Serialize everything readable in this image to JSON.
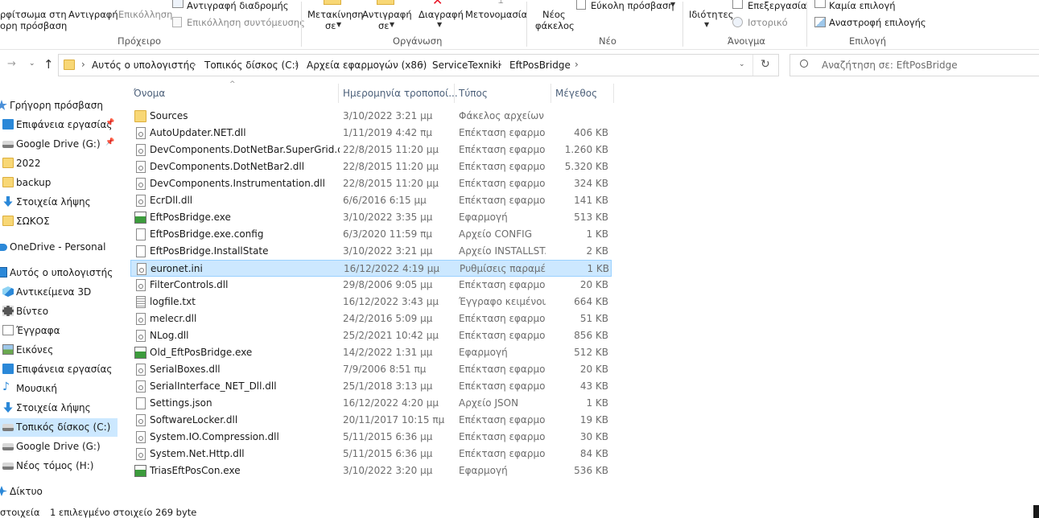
{
  "ribbon": {
    "clipboard": {
      "pin_label_1": "ρφίτσωμα στη",
      "pin_label_2": "ορη πρόσβαση",
      "copy": "Αντιγραφή",
      "paste": "Επικόλληση",
      "copy_path": "Αντιγραφή διαδρομής",
      "paste_shortcut": "Επικόλληση συντόμευσης",
      "group": "Πρόχειρο"
    },
    "organize": {
      "move_to_1": "Μετακίνηση",
      "move_to_2": "σε",
      "copy_to_1": "Αντιγραφή",
      "copy_to_2": "σε",
      "delete": "Διαγραφή",
      "rename": "Μετονομασία",
      "group": "Οργάνωση"
    },
    "new": {
      "new_folder_1": "Νέος",
      "new_folder_2": "φάκελος",
      "easy_access": "Εύκολη πρόσβαση",
      "group": "Νέο"
    },
    "open": {
      "properties": "Ιδιότητες",
      "edit": "Επεξεργασία",
      "history": "Ιστορικό",
      "group": "Άνοιγμα"
    },
    "select": {
      "select_none": "Καμία επιλογή",
      "invert_selection": "Αναστροφή επιλογής",
      "group": "Επιλογή"
    }
  },
  "address": {
    "crumbs": [
      "Αυτός ο υπολογιστής",
      "Τοπικός δίσκος (C:)",
      "Αρχεία εφαρμογών (x86)",
      "ServiceTexniki",
      "EftPosBridge"
    ],
    "search_placeholder": "Αναζήτηση σε: EftPosBridge"
  },
  "sidebar": {
    "items": [
      {
        "label": "Γρήγορη πρόσβαση",
        "icon": "star-icon",
        "pinned": false
      },
      {
        "label": "Επιφάνεια εργασίας",
        "icon": "desktop-icon",
        "pinned": true
      },
      {
        "label": "Google Drive (G:)",
        "icon": "drive-icon",
        "pinned": true
      },
      {
        "label": "2022",
        "icon": "folder-icon",
        "pinned": false
      },
      {
        "label": "backup",
        "icon": "folder-icon",
        "pinned": false
      },
      {
        "label": "Στοιχεία λήψης",
        "icon": "download-icon",
        "pinned": false
      },
      {
        "label": "ΣΩΚΟΣ",
        "icon": "folder-icon",
        "pinned": false
      },
      {
        "label": "OneDrive - Personal",
        "icon": "cloud-icon",
        "pinned": false
      },
      {
        "label": "Αυτός ο υπολογιστής",
        "icon": "computer-icon",
        "pinned": false
      },
      {
        "label": "Αντικείμενα 3D",
        "icon": "cube-icon",
        "pinned": false
      },
      {
        "label": "Βίντεο",
        "icon": "video-icon",
        "pinned": false
      },
      {
        "label": "Έγγραφα",
        "icon": "document-icon",
        "pinned": false
      },
      {
        "label": "Εικόνες",
        "icon": "pictures-icon",
        "pinned": false
      },
      {
        "label": "Επιφάνεια εργασίας",
        "icon": "desktop-icon",
        "pinned": false
      },
      {
        "label": "Μουσική",
        "icon": "music-icon",
        "pinned": false
      },
      {
        "label": "Στοιχεία λήψης",
        "icon": "download-icon",
        "pinned": false
      },
      {
        "label": "Τοπικός δίσκος (C:)",
        "icon": "drive-icon",
        "pinned": false
      },
      {
        "label": "Google Drive (G:)",
        "icon": "drive-icon",
        "pinned": false
      },
      {
        "label": "Νέος τόμος (H:)",
        "icon": "drive-icon",
        "pinned": false
      },
      {
        "label": "Δίκτυο",
        "icon": "network-icon",
        "pinned": false
      }
    ]
  },
  "columns": {
    "name": "Όνομα",
    "date": "Ημερομηνία τροποποί...",
    "type": "Τύπος",
    "size": "Μέγεθος"
  },
  "files": [
    {
      "name": "Sources",
      "date": "3/10/2022 3:21 μμ",
      "type": "Φάκελος αρχείων",
      "size": "",
      "icon": "folder-icon"
    },
    {
      "name": "AutoUpdater.NET.dll",
      "date": "1/11/2019 4:42 πμ",
      "type": "Επέκταση εφαρμο...",
      "size": "406 KB",
      "icon": "dll-icon"
    },
    {
      "name": "DevComponents.DotNetBar.SuperGrid.dll",
      "date": "22/8/2015 11:20 μμ",
      "type": "Επέκταση εφαρμο...",
      "size": "1.260 KB",
      "icon": "dll-icon"
    },
    {
      "name": "DevComponents.DotNetBar2.dll",
      "date": "22/8/2015 11:20 μμ",
      "type": "Επέκταση εφαρμο...",
      "size": "5.320 KB",
      "icon": "dll-icon"
    },
    {
      "name": "DevComponents.Instrumentation.dll",
      "date": "22/8/2015 11:20 μμ",
      "type": "Επέκταση εφαρμο...",
      "size": "324 KB",
      "icon": "dll-icon"
    },
    {
      "name": "EcrDll.dll",
      "date": "6/6/2016 6:15 μμ",
      "type": "Επέκταση εφαρμο...",
      "size": "141 KB",
      "icon": "dll-icon"
    },
    {
      "name": "EftPosBridge.exe",
      "date": "3/10/2022 3:35 μμ",
      "type": "Εφαρμογή",
      "size": "513 KB",
      "icon": "exe-icon"
    },
    {
      "name": "EftPosBridge.exe.config",
      "date": "6/3/2020 11:59 πμ",
      "type": "Αρχείο CONFIG",
      "size": "1 KB",
      "icon": "file-icon"
    },
    {
      "name": "EftPosBridge.InstallState",
      "date": "3/10/2022 3:21 μμ",
      "type": "Αρχείο INSTALLST...",
      "size": "2 KB",
      "icon": "file-icon"
    },
    {
      "name": "euronet.ini",
      "date": "16/12/2022 4:19 μμ",
      "type": "Ρυθμίσεις παραμέ...",
      "size": "1 KB",
      "icon": "settings-file-icon",
      "selected": true
    },
    {
      "name": "FilterControls.dll",
      "date": "29/8/2006 9:05 μμ",
      "type": "Επέκταση εφαρμο...",
      "size": "20 KB",
      "icon": "dll-icon"
    },
    {
      "name": "logfile.txt",
      "date": "16/12/2022 3:43 μμ",
      "type": "Έγγραφο κειμένου",
      "size": "664 KB",
      "icon": "text-file-icon"
    },
    {
      "name": "melecr.dll",
      "date": "24/2/2016 5:09 μμ",
      "type": "Επέκταση εφαρμο...",
      "size": "51 KB",
      "icon": "dll-icon"
    },
    {
      "name": "NLog.dll",
      "date": "25/2/2021 10:42 μμ",
      "type": "Επέκταση εφαρμο...",
      "size": "856 KB",
      "icon": "dll-icon"
    },
    {
      "name": "Old_EftPosBridge.exe",
      "date": "14/2/2022 1:31 μμ",
      "type": "Εφαρμογή",
      "size": "512 KB",
      "icon": "exe-icon"
    },
    {
      "name": "SerialBoxes.dll",
      "date": "7/9/2006 8:51 πμ",
      "type": "Επέκταση εφαρμο...",
      "size": "20 KB",
      "icon": "dll-icon"
    },
    {
      "name": "SerialInterface_NET_Dll.dll",
      "date": "25/1/2018 3:13 μμ",
      "type": "Επέκταση εφαρμο...",
      "size": "43 KB",
      "icon": "dll-icon"
    },
    {
      "name": "Settings.json",
      "date": "16/12/2022 4:20 μμ",
      "type": "Αρχείο JSON",
      "size": "1 KB",
      "icon": "file-icon"
    },
    {
      "name": "SoftwareLocker.dll",
      "date": "20/11/2017 10:15 πμ",
      "type": "Επέκταση εφαρμο...",
      "size": "19 KB",
      "icon": "dll-icon"
    },
    {
      "name": "System.IO.Compression.dll",
      "date": "5/11/2015 6:36 μμ",
      "type": "Επέκταση εφαρμο...",
      "size": "30 KB",
      "icon": "dll-icon"
    },
    {
      "name": "System.Net.Http.dll",
      "date": "5/11/2015 6:36 μμ",
      "type": "Επέκταση εφαρμο...",
      "size": "84 KB",
      "icon": "dll-icon"
    },
    {
      "name": "TriasEftPosCon.exe",
      "date": "3/10/2022 3:20 μμ",
      "type": "Εφαρμογή",
      "size": "536 KB",
      "icon": "exe-icon"
    }
  ],
  "status": {
    "items_label": "στοιχεία",
    "selected_text": "1 επιλεγμένο στοιχείο 269 byte"
  },
  "colors": {
    "selection_bg": "#cce8ff",
    "selection_border": "#99d1ff",
    "header_text": "#4c607a",
    "folder": "#f8d775",
    "delete_red": "#e81123"
  }
}
